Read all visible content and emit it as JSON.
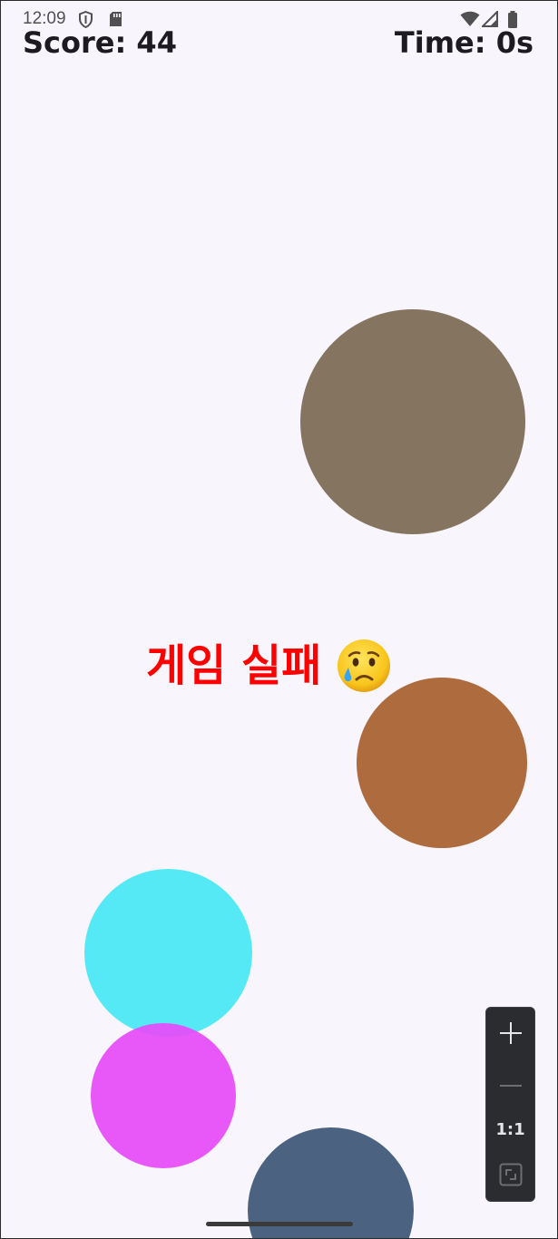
{
  "status_bar": {
    "time": "12:09",
    "icons": [
      "shield-icon",
      "sd-card-icon",
      "wifi-icon",
      "cell-signal-icon",
      "battery-icon"
    ]
  },
  "hud": {
    "score_label": "Score: 44",
    "time_label": "Time: 0s"
  },
  "game_over": {
    "message": "게임 실패",
    "emoji_icon": "crying-face-icon",
    "color": "#ff0000"
  },
  "balls": [
    {
      "name": "ball-gray-brown",
      "color": "#857560"
    },
    {
      "name": "ball-brown",
      "color": "#ae6b3e"
    },
    {
      "name": "ball-cyan",
      "color": "#55e9f5"
    },
    {
      "name": "ball-magenta",
      "color": "#e64bf9"
    },
    {
      "name": "ball-slate-blue",
      "color": "#4b6381"
    }
  ],
  "zoom_controls": {
    "zoom_in_icon": "plus-icon",
    "zoom_out_icon": "minus-icon",
    "reset_label": "1:1",
    "fit_icon": "fit-screen-icon"
  },
  "colors": {
    "background": "#f8f5fc",
    "hud_text": "#1d1b20"
  }
}
